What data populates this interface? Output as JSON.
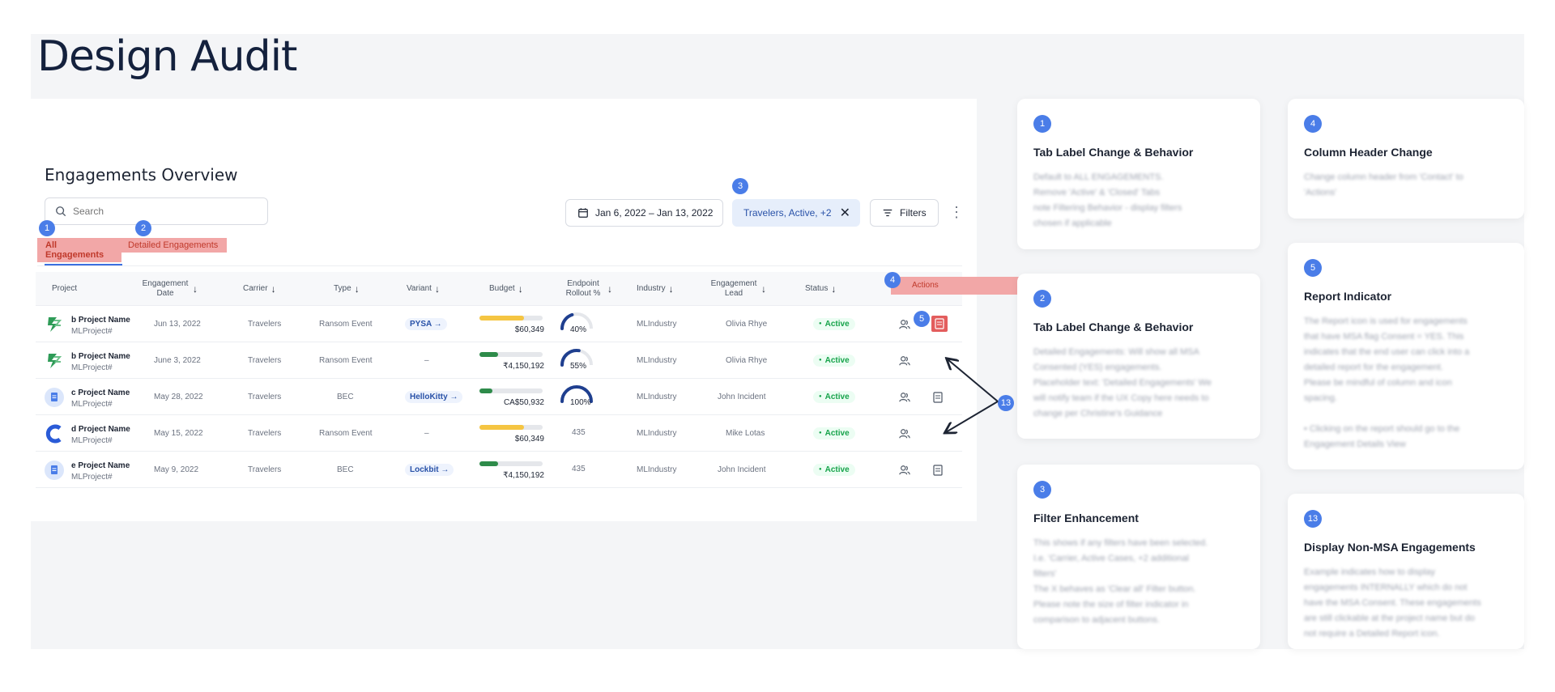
{
  "page_title": "Design Audit",
  "overview": {
    "title": "Engagements Overview",
    "search_placeholder": "Search",
    "tabs": [
      "All Engagements",
      "Detailed Engagements"
    ],
    "date_range": "Jan 6, 2022 – Jan 13, 2022",
    "filter_chip": "Travelers, Active, +2",
    "filters_label": "Filters",
    "columns": [
      "Project",
      "Engagement Date",
      "Carrier",
      "Type",
      "Variant",
      "Budget",
      "Endpoint Rollout %",
      "Industry",
      "Engagement Lead",
      "Status",
      "Actions"
    ],
    "rows": [
      {
        "name": "b Project Name",
        "sub": "MLProject#",
        "icon": "green-bolt-icon",
        "date": "Jun 13, 2022",
        "carrier": "Travelers",
        "type": "Ransom Event",
        "variant": "PYSA →",
        "budget": "$60,349",
        "budget_pct": 0.7,
        "budget_color": "#f5c542",
        "rollout": "40%",
        "rollout_pct": 0.4,
        "industry": "MLIndustry",
        "lead": "Olivia Rhye",
        "status": "Active",
        "report": true
      },
      {
        "name": "b Project Name",
        "sub": "MLProject#",
        "icon": "green-bolt-icon",
        "date": "June 3, 2022",
        "carrier": "Travelers",
        "type": "Ransom Event",
        "variant": "–",
        "budget": "₹4,150,192",
        "budget_pct": 0.3,
        "budget_color": "#2e8b4a",
        "rollout": "55%",
        "rollout_pct": 0.55,
        "industry": "MLIndustry",
        "lead": "Olivia Rhye",
        "status": "Active",
        "report": false
      },
      {
        "name": "c Project Name",
        "sub": "MLProject#",
        "icon": "document-icon",
        "date": "May 28, 2022",
        "carrier": "Travelers",
        "type": "BEC",
        "variant": "HelloKitty →",
        "budget": "CA$50,932",
        "budget_pct": 0.2,
        "budget_color": "#2e8b4a",
        "rollout": "100%",
        "rollout_pct": 1.0,
        "industry": "MLIndustry",
        "lead": "John Incident",
        "status": "Active",
        "report": true
      },
      {
        "name": "d Project Name",
        "sub": "MLProject#",
        "icon": "c-logo-icon",
        "date": "May 15, 2022",
        "carrier": "Travelers",
        "type": "Ransom Event",
        "variant": "–",
        "budget": "$60,349",
        "budget_pct": 0.7,
        "budget_color": "#f5c542",
        "rollout": "435",
        "rollout_pct": null,
        "industry": "MLIndustry",
        "lead": "Mike Lotas",
        "status": "Active",
        "report": false
      },
      {
        "name": "e Project Name",
        "sub": "MLProject#",
        "icon": "document-icon",
        "date": "May 9, 2022",
        "carrier": "Travelers",
        "type": "BEC",
        "variant": "Lockbit →",
        "budget": "₹4,150,192",
        "budget_pct": 0.3,
        "budget_color": "#2e8b4a",
        "rollout": "435",
        "rollout_pct": null,
        "industry": "MLIndustry",
        "lead": "John Incident",
        "status": "Active",
        "report": true
      }
    ]
  },
  "markers": [
    "1",
    "2",
    "3",
    "4",
    "5",
    "13"
  ],
  "cards": [
    {
      "num": "1",
      "title": "Tab Label Change & Behavior",
      "body": "Default to ALL ENGAGEMENTS.\nRemove 'Active' & 'Closed' Tabs\nnote Filtering Behavior - display filters\nchosen if applicable"
    },
    {
      "num": "2",
      "title": "Tab Label Change & Behavior",
      "body": "Detailed Engagements: Will show all MSA\nConsented (YES) engagements.\nPlaceholder text: 'Detailed Engagements' We\nwill notify team if the UX Copy here needs to\nchange per Christine's Guidance"
    },
    {
      "num": "3",
      "title": "Filter Enhancement",
      "body": "This shows if any filters have been selected.\nI.e. 'Carrier, Active Cases, +2 additional\nfilters'\nThe X behaves as 'Clear all' Filter button.\nPlease note the size of filter indicator in\ncomparison to adjacent buttons."
    },
    {
      "num": "4",
      "title": "Column Header Change",
      "body": "Change column header from 'Contact' to\n'Actions'"
    },
    {
      "num": "5",
      "title": "Report Indicator",
      "body": "The Report icon is used for engagements\nthat have MSA flag Consent = YES. This\nindicates that the end user can click into a\ndetailed report for the engagement.\nPlease be mindful of column and icon\nspacing.\n\n • Clicking on the report should go to the\n    Engagement Details View"
    },
    {
      "num": "13",
      "title": "Display Non-MSA Engagements",
      "body": "Example indicates how to display\nengagements INTERNALLY which do not\nhave the MSA Consent. These engagements\nare still clickable at the project name but do\nnot require a Detailed Report icon."
    }
  ]
}
